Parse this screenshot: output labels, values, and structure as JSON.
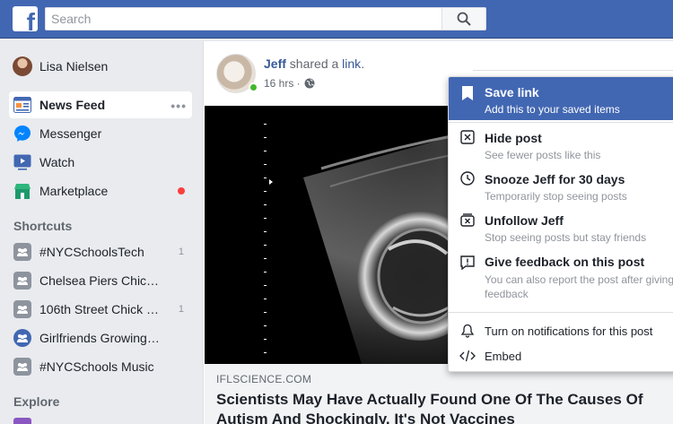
{
  "topbar": {
    "logo_letter": "f",
    "search_placeholder": "Search"
  },
  "sidebar": {
    "user": {
      "name": "Lisa Nielsen"
    },
    "nav": [
      {
        "label": "News Feed",
        "icon": "news-feed-icon",
        "active": true,
        "more": "•••"
      },
      {
        "label": "Messenger",
        "icon": "messenger-icon"
      },
      {
        "label": "Watch",
        "icon": "watch-icon"
      },
      {
        "label": "Marketplace",
        "icon": "marketplace-icon",
        "notify": true
      }
    ],
    "shortcuts_title": "Shortcuts",
    "shortcuts": [
      {
        "label": "#NYCSchoolsTech",
        "count": "1"
      },
      {
        "label": "Chelsea Piers Chic…",
        "count": ""
      },
      {
        "label": "106th Street Chick …",
        "count": "1"
      },
      {
        "label": "Girlfriends Growing…",
        "count": ""
      },
      {
        "label": "#NYCSchools Music",
        "count": ""
      }
    ],
    "explore_title": "Explore"
  },
  "post": {
    "author": "Jeff",
    "action": " shared a ",
    "object": "link",
    "suffix": ".",
    "time": "16 hrs ·",
    "link_domain": "IFLSCIENCE.COM",
    "link_title": "Scientists May Have Actually Found One Of The Causes Of Autism And Shockingly, It's Not Vaccines"
  },
  "menu": {
    "save": {
      "title": "Save link",
      "sub": "Add this to your saved items"
    },
    "hide": {
      "title": "Hide post",
      "sub": "See fewer posts like this"
    },
    "snooze": {
      "title": "Snooze Jeff for 30 days",
      "sub": "Temporarily stop seeing posts"
    },
    "unfollow": {
      "title": "Unfollow Jeff",
      "sub": "Stop seeing posts but stay friends"
    },
    "feedback": {
      "title": "Give feedback on this post",
      "sub": "You can also report the post after giving feedback"
    },
    "notifications": "Turn on notifications for this post",
    "embed": "Embed"
  },
  "colors": {
    "brand": "#4267b2",
    "link": "#365899",
    "online": "#42b72a",
    "notify": "#fa3e3e"
  }
}
